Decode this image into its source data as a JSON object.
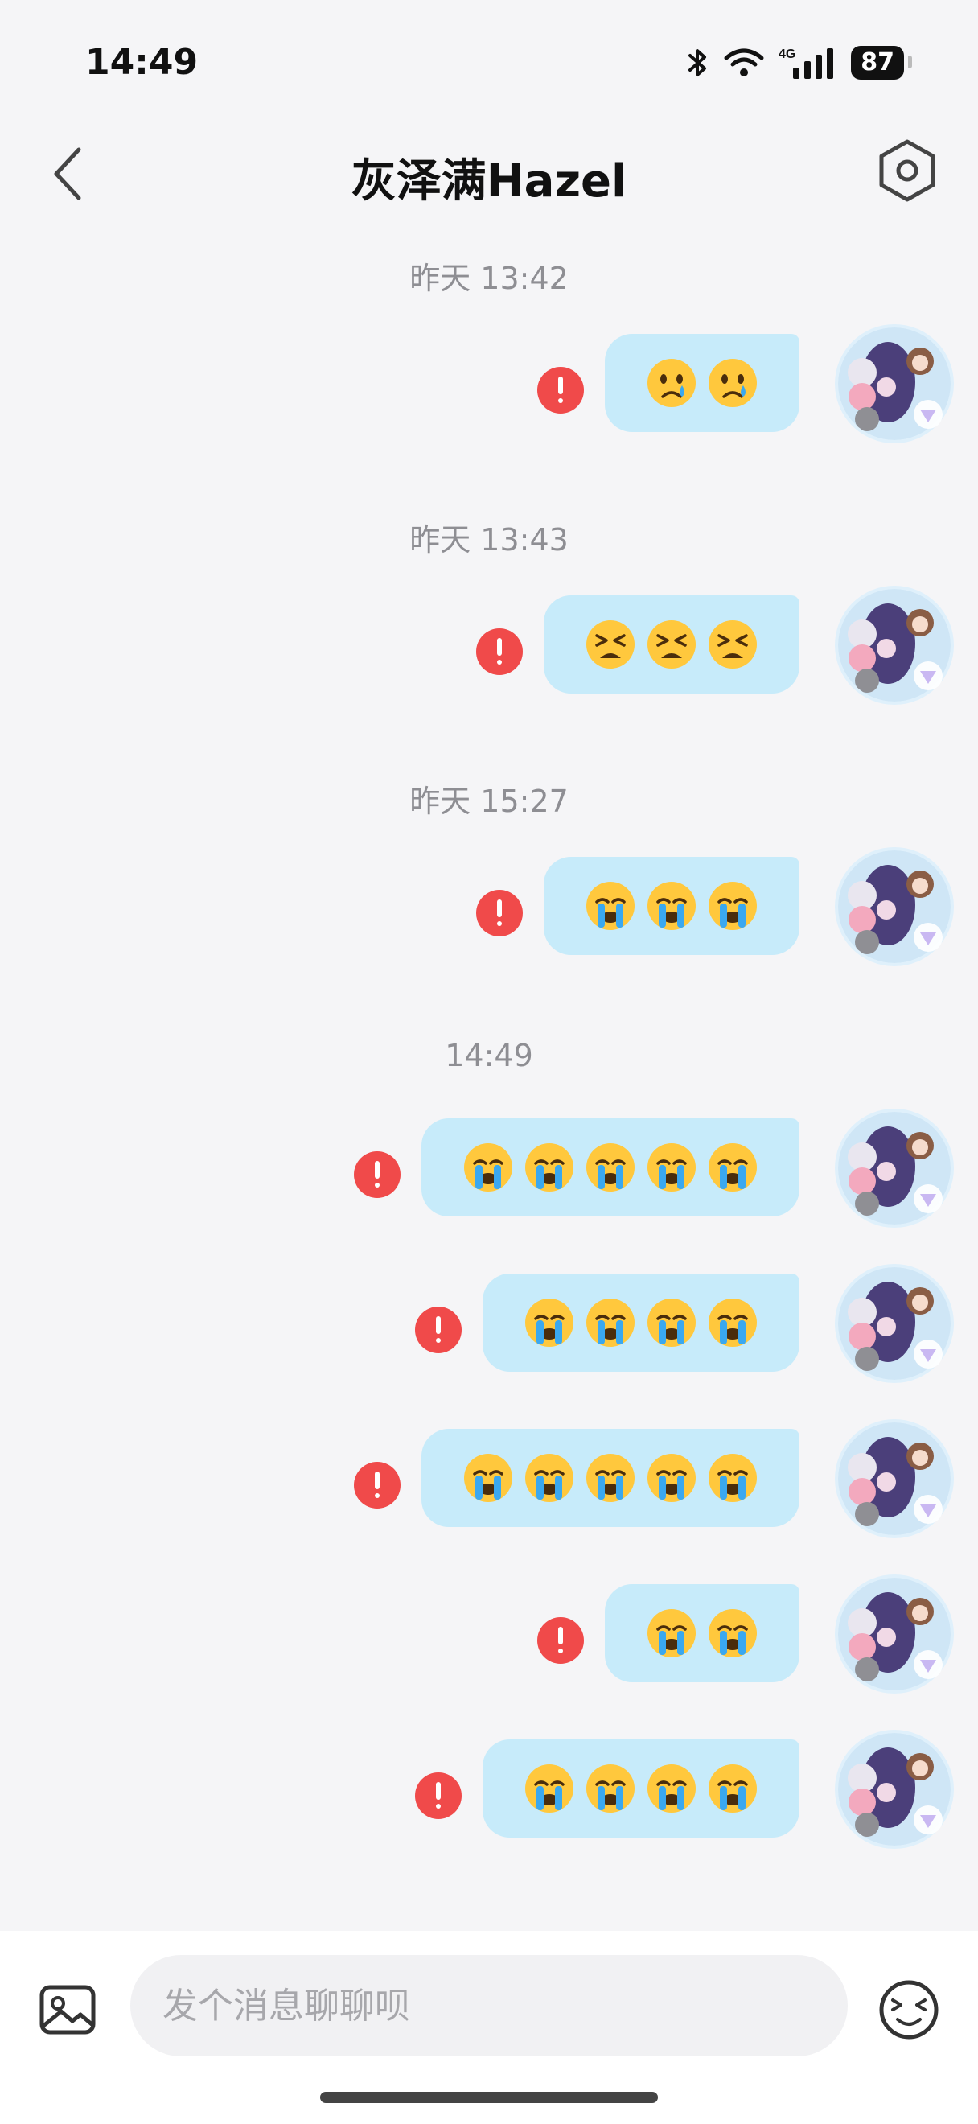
{
  "status_bar": {
    "time": "14:49",
    "battery": "87",
    "network": "4G"
  },
  "header": {
    "title": "灰泽满Hazel"
  },
  "emoji_colors": {
    "face": "#ffc83d",
    "tear": "#3aa8f0",
    "feature": "#4a2d0c"
  },
  "messages": [
    {
      "timestamp": "昨天 13:42",
      "emojis": [
        "crying-face",
        "crying-face"
      ],
      "status": "failed"
    },
    {
      "timestamp": "昨天 13:43",
      "emojis": [
        "tired-face",
        "tired-face",
        "tired-face"
      ],
      "status": "failed"
    },
    {
      "timestamp": "昨天 15:27",
      "emojis": [
        "loudly-crying-face",
        "loudly-crying-face",
        "loudly-crying-face"
      ],
      "status": "failed"
    },
    {
      "timestamp": "14:49",
      "emojis": [
        "loudly-crying-face",
        "loudly-crying-face",
        "loudly-crying-face",
        "loudly-crying-face",
        "loudly-crying-face"
      ],
      "status": "failed"
    },
    {
      "timestamp": "",
      "emojis": [
        "loudly-crying-face",
        "loudly-crying-face",
        "loudly-crying-face",
        "loudly-crying-face"
      ],
      "status": "failed"
    },
    {
      "timestamp": "",
      "emojis": [
        "loudly-crying-face",
        "loudly-crying-face",
        "loudly-crying-face",
        "loudly-crying-face",
        "loudly-crying-face"
      ],
      "status": "failed"
    },
    {
      "timestamp": "",
      "emojis": [
        "loudly-crying-face",
        "loudly-crying-face"
      ],
      "status": "failed"
    },
    {
      "timestamp": "",
      "emojis": [
        "loudly-crying-face",
        "loudly-crying-face",
        "loudly-crying-face",
        "loudly-crying-face"
      ],
      "status": "failed"
    }
  ],
  "input": {
    "placeholder": "发个消息聊聊呗",
    "value": ""
  }
}
